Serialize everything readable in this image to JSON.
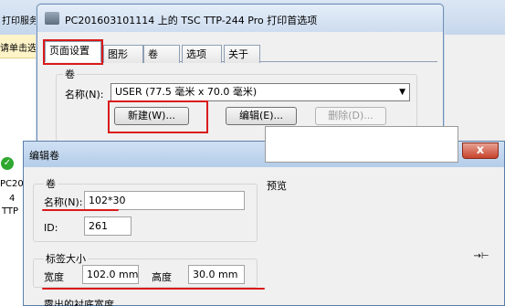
{
  "background": {
    "left_title": "打印服务",
    "strip_text": "请单击选",
    "printer_item": {
      "name_line1": "PC20",
      "name_line2": "4",
      "name_line3": "TTP"
    }
  },
  "pref_window": {
    "title": "PC201603101114 上的 TSC TTP-244 Pro 打印首选项",
    "tabs": [
      "页面设置",
      "图形",
      "卷",
      "选项",
      "关于"
    ],
    "group_label": "卷",
    "name_label": "名称(N):",
    "name_value": "USER (77.5 毫米 x 70.0 毫米)",
    "btn_new": "新建(W)...",
    "btn_edit": "编辑(E)...",
    "btn_delete": "删除(D)..."
  },
  "edit_dialog": {
    "title": "编辑卷",
    "close_glyph": "x",
    "volume_group": "卷",
    "name_label": "名称(N):",
    "name_value": "102*30",
    "id_label": "ID:",
    "id_value": "261",
    "preview_label": "预览",
    "label_size_group": "标签大小",
    "width_label": "宽度",
    "width_value": "102.0 mm",
    "height_label": "高度",
    "height_value": "30.0 mm",
    "bottom_group": "露出的衬底宽度"
  },
  "colors": {
    "highlight": "#d91a1a",
    "title_bar": "#cddcef"
  }
}
